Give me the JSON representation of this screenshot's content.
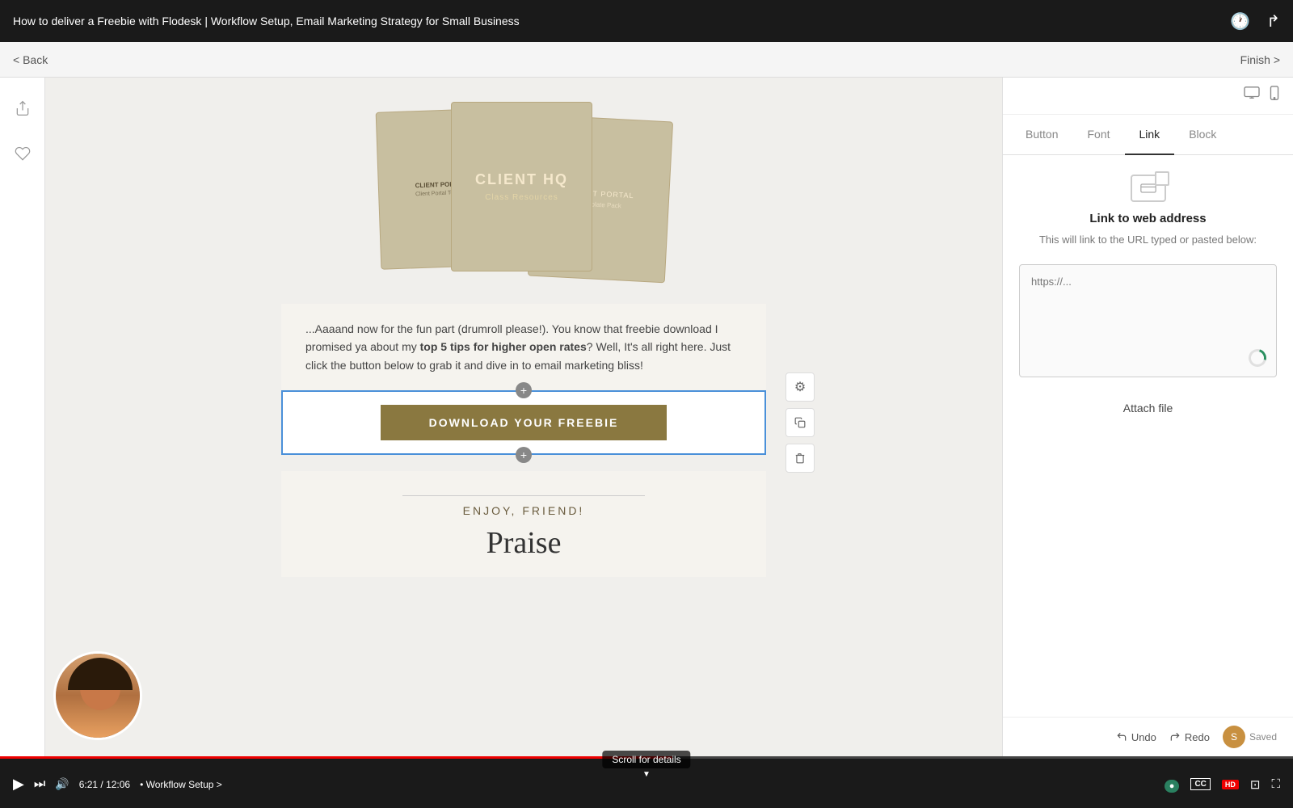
{
  "title_bar": {
    "title": "How to deliver a Freebie with Flodesk | Workflow Setup, Email Marketing Strategy for Small Business",
    "clock_icon": "🕐",
    "share_icon": "→"
  },
  "nav": {
    "back_label": "< Back",
    "finish_label": "Finish >"
  },
  "view_icons": {
    "desktop": "desktop",
    "mobile": "mobile"
  },
  "right_tabs": [
    {
      "id": "button",
      "label": "Button"
    },
    {
      "id": "font",
      "label": "Font"
    },
    {
      "id": "link",
      "label": "Link",
      "active": true
    },
    {
      "id": "block",
      "label": "Block"
    }
  ],
  "link_panel": {
    "icon_label": "link-icon",
    "title": "Link to web address",
    "description": "This will link to the URL typed\nor pasted below:",
    "url_placeholder": "https://...",
    "attach_file_label": "Attach file"
  },
  "content": {
    "product_title": "CLIENT HQ",
    "product_subtitle": "Class Resources",
    "body_text_1": "...Aaaand now for the fun part (drumroll please!). You know that freebie download I\npromised ya about my ",
    "body_highlight": "top 5 tips for higher open rates",
    "body_text_2": "? Well, It's all right here.\nJust click the button below to grab it and dive in to email marketing bliss!",
    "download_button_label": "DOWNLOAD YOUR FREEBIE",
    "enjoy_text": "ENJOY, FRIEND!",
    "signature": "Praise"
  },
  "toolbar": {
    "undo_label": "Undo",
    "redo_label": "Redo",
    "saved_label": "Saved",
    "saved_initial": "S"
  },
  "video_player": {
    "current_time": "6:21",
    "total_time": "12:06",
    "chapter": "Workflow Setup",
    "progress_percent": 52,
    "scroll_hint": "Scroll for details"
  }
}
